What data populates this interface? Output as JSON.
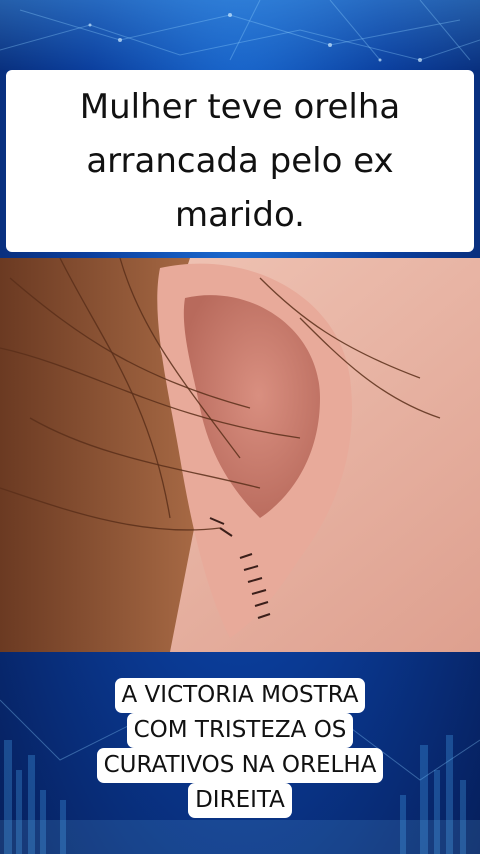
{
  "post": {
    "headline": "Mulher teve orelha arrancada pelo ex marido.",
    "caption_lines": [
      "A VICTORIA MOSTRA",
      "COM TRISTEZA OS",
      "CURATIVOS NA ORELHA",
      "DIREITA"
    ]
  },
  "colors": {
    "background": "#0b3f9e",
    "card": "#ffffff",
    "text": "#111111",
    "skin": "#e9b4a4"
  },
  "photo": {
    "icon": "ear-photo"
  }
}
